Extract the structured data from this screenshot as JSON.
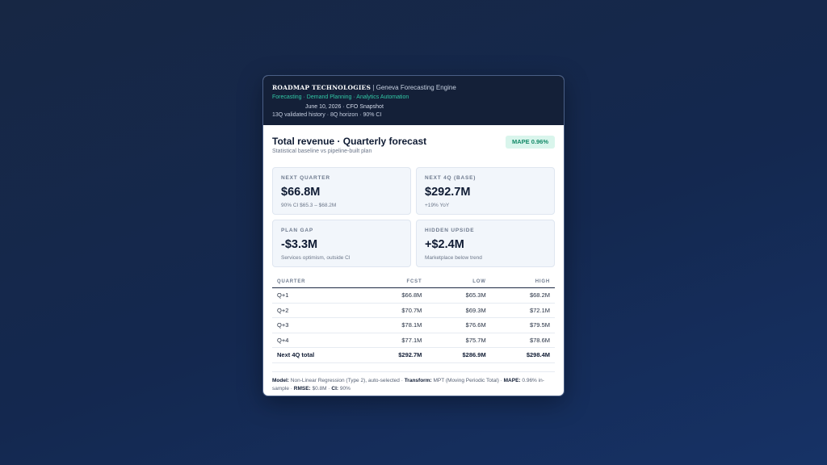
{
  "header": {
    "brand": "ROADMAP TECHNOLOGIES",
    "separator": "|",
    "product": "Geneva Forecasting Engine",
    "tagline": "Forecasting · Demand Planning · Analytics Automation",
    "snapshot": "June 10, 2026 · CFO Snapshot",
    "history": "13Q validated history · 8Q horizon · 90% CI"
  },
  "panel": {
    "title": "Total revenue · Quarterly forecast",
    "subtitle": "Statistical baseline vs pipeline-built plan",
    "badge": "MAPE 0.96%"
  },
  "kpis": [
    {
      "label": "NEXT QUARTER",
      "value": "$66.8M",
      "note": "90% CI $65.3 – $68.2M"
    },
    {
      "label": "NEXT 4Q (BASE)",
      "value": "$292.7M",
      "note": "+19% YoY"
    },
    {
      "label": "PLAN GAP",
      "value": "-$3.3M",
      "note": "Services optimism, outside CI"
    },
    {
      "label": "HIDDEN UPSIDE",
      "value": "+$2.4M",
      "note": "Marketplace below trend"
    }
  ],
  "table": {
    "columns": [
      "QUARTER",
      "FCST",
      "LOW",
      "HIGH"
    ],
    "rows": [
      [
        "Q+1",
        "$66.8M",
        "$65.3M",
        "$68.2M"
      ],
      [
        "Q+2",
        "$70.7M",
        "$69.3M",
        "$72.1M"
      ],
      [
        "Q+3",
        "$78.1M",
        "$76.6M",
        "$79.5M"
      ],
      [
        "Q+4",
        "$77.1M",
        "$75.7M",
        "$78.6M"
      ]
    ],
    "total": [
      "Next 4Q total",
      "$292.7M",
      "$286.9M",
      "$298.4M"
    ]
  },
  "footer": {
    "model_label": "Model:",
    "model": "Non-Linear Regression (Type 2), auto-selected ·",
    "transform_label": "Transform:",
    "transform": "MPT (Moving Periodic Total) ·",
    "mape_label": "MAPE:",
    "mape": "0.96% in-sample ·",
    "rmse_label": "RMSE:",
    "rmse": "$0.8M ·",
    "ci_label": "CI:",
    "ci": "90%"
  }
}
